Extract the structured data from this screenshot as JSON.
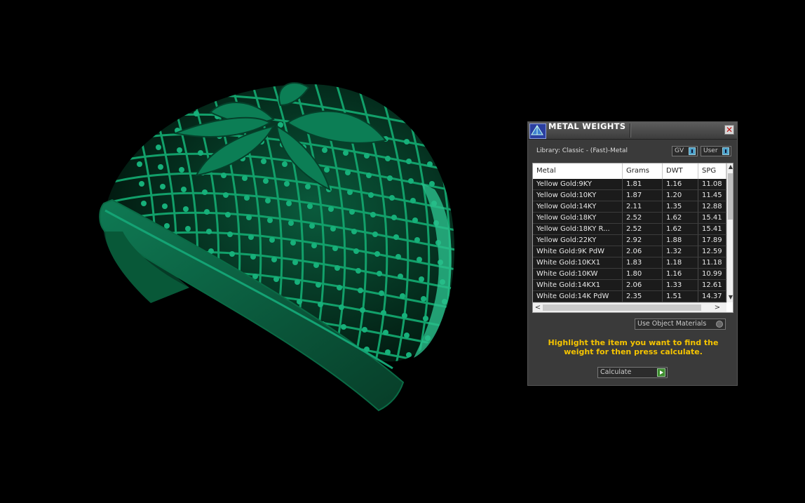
{
  "panel": {
    "title": "METAL WEIGHTS",
    "library_label": "Library: Classic - (Fast)-Metal",
    "toggle_gv": "GV",
    "toggle_user": "User",
    "columns": [
      "Metal",
      "Grams",
      "DWT",
      "SPG"
    ],
    "rows": [
      [
        "Yellow Gold:9KY",
        "1.81",
        "1.16",
        "11.08"
      ],
      [
        "Yellow Gold:10KY",
        "1.87",
        "1.20",
        "11.45"
      ],
      [
        "Yellow Gold:14KY",
        "2.11",
        "1.35",
        "12.88"
      ],
      [
        "Yellow Gold:18KY",
        "2.52",
        "1.62",
        "15.41"
      ],
      [
        "Yellow Gold:18KY R...",
        "2.52",
        "1.62",
        "15.41"
      ],
      [
        "Yellow Gold:22KY",
        "2.92",
        "1.88",
        "17.89"
      ],
      [
        "White Gold:9K PdW",
        "2.06",
        "1.32",
        "12.59"
      ],
      [
        "White Gold:10KX1",
        "1.83",
        "1.18",
        "11.18"
      ],
      [
        "White Gold:10KW",
        "1.80",
        "1.16",
        "10.99"
      ],
      [
        "White Gold:14KX1",
        "2.06",
        "1.33",
        "12.61"
      ],
      [
        "White Gold:14K PdW",
        "2.35",
        "1.51",
        "14.37"
      ]
    ],
    "use_object_materials": "Use Object Materials",
    "hint": "Highlight the item you want to find the weight for then press calculate.",
    "calculate": "Calculate"
  },
  "colors": {
    "model_green": "#0b7a52",
    "hint_yellow": "#f5c400",
    "panel_bg": "#3a3a3a"
  }
}
